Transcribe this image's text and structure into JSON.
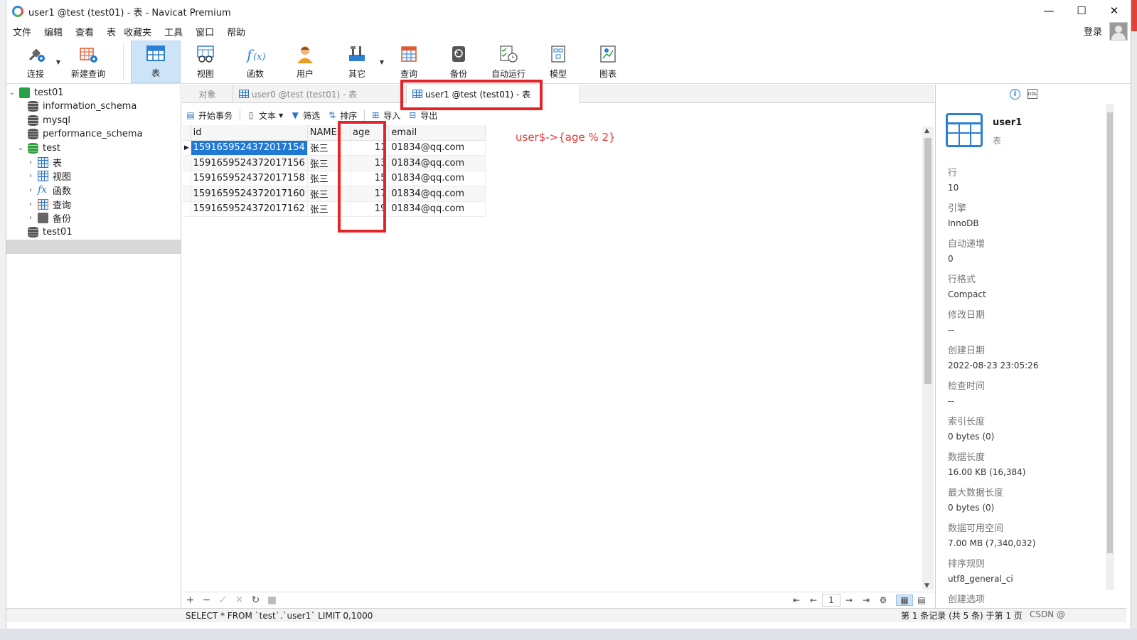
{
  "window": {
    "title": "user1 @test (test01) - 表 - Navicat Premium",
    "controls": [
      "—",
      "☐",
      "✕"
    ]
  },
  "menu": [
    "文件",
    "编辑",
    "查看",
    "表",
    "收藏夹",
    "工具",
    "窗口",
    "帮助"
  ],
  "login_label": "登录",
  "toolbar": {
    "buttons": [
      "连接",
      "新建查询",
      "表",
      "视图",
      "函数",
      "用户",
      "其它",
      "查询",
      "备份",
      "自动运行",
      "模型",
      "图表"
    ],
    "active": "表"
  },
  "tree": {
    "connection": "test01",
    "databases": [
      "information_schema",
      "mysql",
      "performance_schema",
      "test",
      "test01"
    ],
    "children": [
      "表",
      "视图",
      "函数",
      "查询",
      "备份"
    ]
  },
  "tabs": [
    "对象",
    "user0 @test (test01) - 表",
    "user1 @test (test01) - 表"
  ],
  "data_toolbar": [
    "开始事务",
    "文本",
    "筛选",
    "排序",
    "导入",
    "导出"
  ],
  "grid": {
    "columns": [
      "id",
      "NAME",
      "age",
      "email"
    ],
    "rows": [
      {
        "id": "1591659524372017154",
        "name": "张三",
        "age": "11",
        "email": "01834@qq.com"
      },
      {
        "id": "1591659524372017156",
        "name": "张三",
        "age": "13",
        "email": "01834@qq.com"
      },
      {
        "id": "1591659524372017158",
        "name": "张三",
        "age": "15",
        "email": "01834@qq.com"
      },
      {
        "id": "1591659524372017160",
        "name": "张三",
        "age": "17",
        "email": "01834@qq.com"
      },
      {
        "id": "1591659524372017162",
        "name": "张三",
        "age": "19",
        "email": "01834@qq.com"
      }
    ]
  },
  "annotation": "user$->{age % 2}",
  "pager": {
    "page": "1"
  },
  "status": {
    "sql": "SELECT * FROM `test`.`user1` LIMIT 0,1000",
    "count": "第 1 条记录 (共 5 条) 于第 1 页"
  },
  "watermark": "CSDN @",
  "info_panel": {
    "name": "user1",
    "type": "表",
    "props": [
      {
        "k": "行",
        "v": "10"
      },
      {
        "k": "引擎",
        "v": "InnoDB"
      },
      {
        "k": "自动递增",
        "v": "0"
      },
      {
        "k": "行格式",
        "v": "Compact"
      },
      {
        "k": "修改日期",
        "v": "--"
      },
      {
        "k": "创建日期",
        "v": "2022-08-23 23:05:26"
      },
      {
        "k": "检查时间",
        "v": "--"
      },
      {
        "k": "索引长度",
        "v": "0 bytes (0)"
      },
      {
        "k": "数据长度",
        "v": "16.00 KB (16,384)"
      },
      {
        "k": "最大数据长度",
        "v": "0 bytes (0)"
      },
      {
        "k": "数据可用空间",
        "v": "7.00 MB (7,340,032)"
      },
      {
        "k": "排序规则",
        "v": "utf8_general_ci"
      },
      {
        "k": "创建选项",
        "v": ""
      }
    ]
  },
  "colors": {
    "accent": "#1e78d4",
    "highlight_box": "#e5242a",
    "annotation": "#e53935"
  }
}
